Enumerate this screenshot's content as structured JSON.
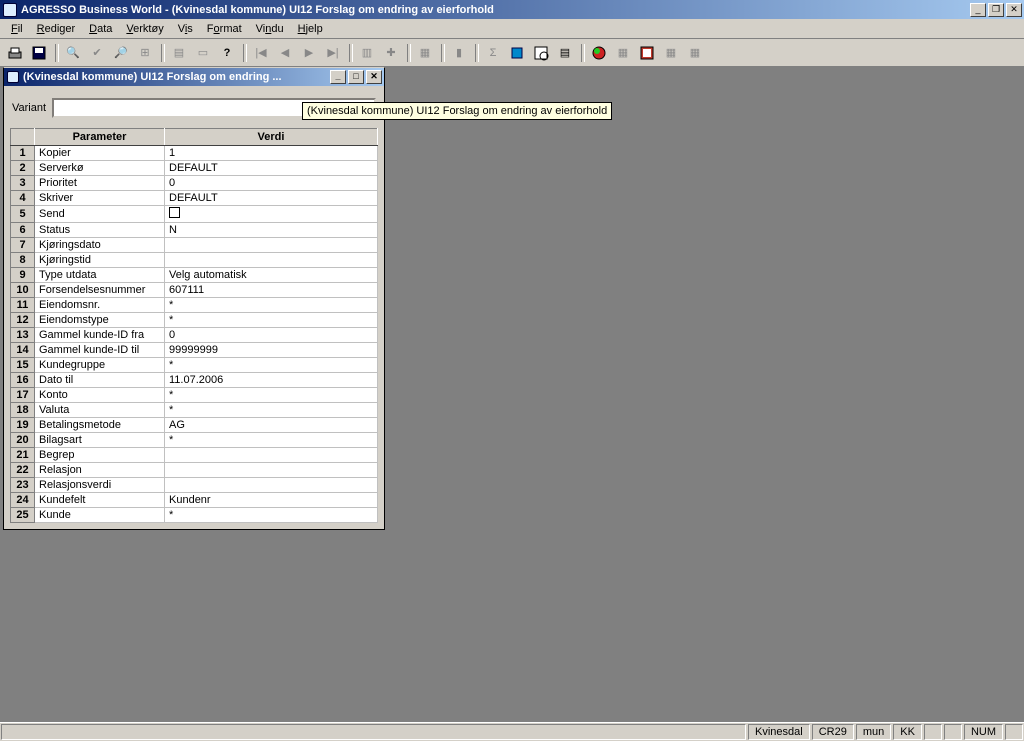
{
  "app": {
    "title": "AGRESSO Business World - (Kvinesdal kommune) UI12 Forslag om endring av eierforhold"
  },
  "menu": {
    "fil": "Fil",
    "rediger": "Rediger",
    "data": "Data",
    "verktoy": "Verktøy",
    "vis": "Vis",
    "format": "Format",
    "vindu": "Vindu",
    "hjelp": "Hjelp"
  },
  "child": {
    "title": "(Kvinesdal kommune) UI12 Forslag om endring ...",
    "tooltip": "(Kvinesdal kommune) UI12 Forslag om endring av eierforhold",
    "variant_label": "Variant",
    "variant_value": ""
  },
  "table": {
    "headers": {
      "parameter": "Parameter",
      "verdi": "Verdi"
    },
    "rows": [
      {
        "n": "1",
        "param": "Kopier",
        "verdi": "1"
      },
      {
        "n": "2",
        "param": "Serverkø",
        "verdi": "DEFAULT"
      },
      {
        "n": "3",
        "param": "Prioritet",
        "verdi": "0"
      },
      {
        "n": "4",
        "param": "Skriver",
        "verdi": "DEFAULT"
      },
      {
        "n": "5",
        "param": "Send",
        "verdi": "",
        "checkbox": true
      },
      {
        "n": "6",
        "param": "Status",
        "verdi": "N"
      },
      {
        "n": "7",
        "param": "Kjøringsdato",
        "verdi": ""
      },
      {
        "n": "8",
        "param": "Kjøringstid",
        "verdi": ""
      },
      {
        "n": "9",
        "param": "Type utdata",
        "verdi": "Velg automatisk"
      },
      {
        "n": "10",
        "param": "Forsendelsesnummer",
        "verdi": "607111"
      },
      {
        "n": "11",
        "param": "Eiendomsnr.",
        "verdi": "*"
      },
      {
        "n": "12",
        "param": "Eiendomstype",
        "verdi": "*"
      },
      {
        "n": "13",
        "param": "Gammel kunde-ID fra",
        "verdi": "0"
      },
      {
        "n": "14",
        "param": "Gammel kunde-ID til",
        "verdi": "99999999"
      },
      {
        "n": "15",
        "param": "Kundegruppe",
        "verdi": "*"
      },
      {
        "n": "16",
        "param": "Dato til",
        "verdi": "11.07.2006"
      },
      {
        "n": "17",
        "param": "Konto",
        "verdi": "*"
      },
      {
        "n": "18",
        "param": "Valuta",
        "verdi": "*"
      },
      {
        "n": "19",
        "param": "Betalingsmetode",
        "verdi": "AG"
      },
      {
        "n": "20",
        "param": "Bilagsart",
        "verdi": "*"
      },
      {
        "n": "21",
        "param": "Begrep",
        "verdi": ""
      },
      {
        "n": "22",
        "param": "Relasjon",
        "verdi": ""
      },
      {
        "n": "23",
        "param": "Relasjonsverdi",
        "verdi": ""
      },
      {
        "n": "24",
        "param": "Kundefelt",
        "verdi": "Kundenr"
      },
      {
        "n": "25",
        "param": "Kunde",
        "verdi": "*"
      }
    ]
  },
  "status": {
    "c1": "Kvinesdal",
    "c2": "CR29",
    "c3": "mun",
    "c4": "KK",
    "num": "NUM"
  }
}
